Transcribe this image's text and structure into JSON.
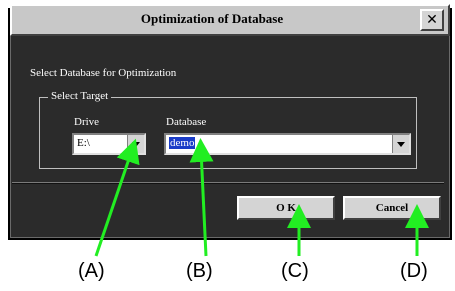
{
  "dialog": {
    "title": "Optimization of Database",
    "close_glyph": "✕",
    "prompt": "Select Database for Optimization",
    "group_label": "Select Target",
    "drive": {
      "label": "Drive",
      "value": "E:\\"
    },
    "database": {
      "label": "Database",
      "value": "demo"
    },
    "ok_label": "O K",
    "cancel_label": "Cancel"
  },
  "annotations": {
    "A": "(A)",
    "B": "(B)",
    "C": "(C)",
    "D": "(D)",
    "arrow_color": "#22ee22"
  }
}
